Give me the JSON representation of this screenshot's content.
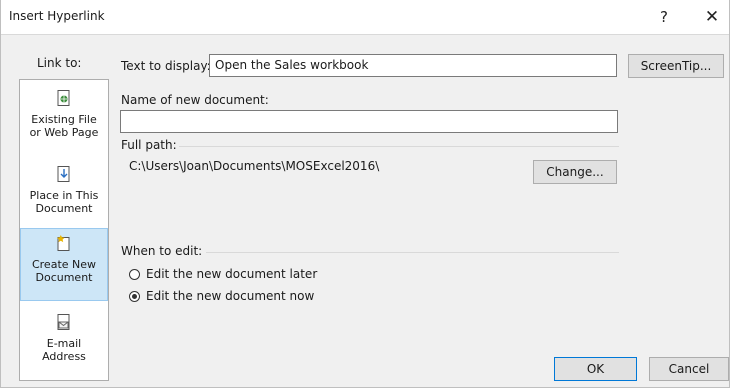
{
  "window": {
    "title": "Insert Hyperlink",
    "help_glyph": "?",
    "close_glyph": "✕"
  },
  "link_to": {
    "label": "Link to:",
    "items": [
      {
        "label_line1": "Existing File",
        "label_line2": "or Web Page",
        "icon": "existing-file-icon"
      },
      {
        "label_line1": "Place in This",
        "label_line2": "Document",
        "icon": "place-in-document-icon"
      },
      {
        "label_line1": "Create New",
        "label_line2": "Document",
        "icon": "create-new-document-icon",
        "selected": true
      },
      {
        "label_line1": "E-mail",
        "label_line2": "Address",
        "icon": "email-address-icon"
      }
    ]
  },
  "text_to_display": {
    "label": "Text to display:",
    "value": "Open the Sales workbook"
  },
  "screentip_button": "ScreenTip...",
  "new_document": {
    "label": "Name of new document:",
    "value": ""
  },
  "full_path": {
    "label": "Full path:",
    "value": "C:\\Users\\Joan\\Documents\\MOSExcel2016\\"
  },
  "change_button": "Change...",
  "when_to_edit": {
    "label": "When to edit:",
    "options": [
      {
        "label": "Edit the new document later",
        "checked": false
      },
      {
        "label": "Edit the new document now",
        "checked": true
      }
    ]
  },
  "ok_button": "OK",
  "cancel_button": "Cancel",
  "colors": {
    "selection_bg": "#cde6f7",
    "selection_border": "#99c9ef",
    "default_button_border": "#0078d7"
  }
}
